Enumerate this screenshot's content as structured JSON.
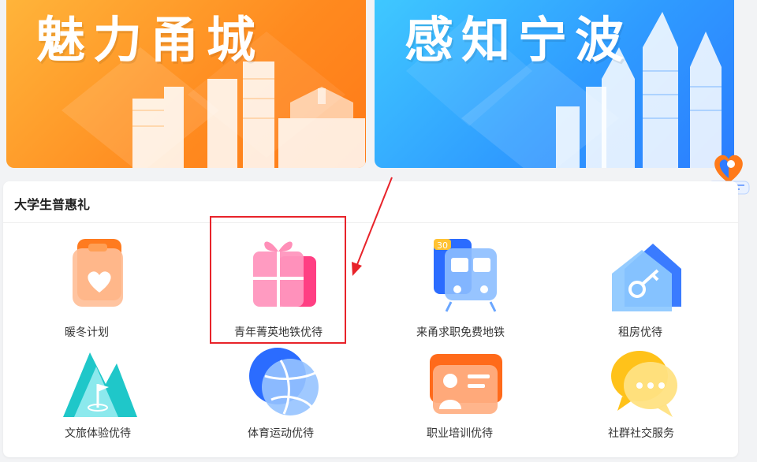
{
  "banners": [
    {
      "title": "魅力甬城"
    },
    {
      "title": "感知宁波"
    }
  ],
  "section": {
    "title": "大学生普惠礼",
    "items": [
      {
        "label": "暖冬计划",
        "icon": "heart-card-icon"
      },
      {
        "label": "青年菁英地铁优待",
        "icon": "gift-box-icon"
      },
      {
        "label": "来甬求职免费地铁",
        "icon": "metro-train-icon"
      },
      {
        "label": "租房优待",
        "icon": "house-key-icon"
      },
      {
        "label": "文旅体验优待",
        "icon": "mountain-flag-icon"
      },
      {
        "label": "体育运动优待",
        "icon": "basketball-icon"
      },
      {
        "label": "职业培训优待",
        "icon": "trainer-board-icon"
      },
      {
        "label": "社群社交服务",
        "icon": "chat-bubbles-icon"
      }
    ]
  },
  "train_badge": "30",
  "colors": {
    "highlight": "#e8232a",
    "orange": "#ff8a1f",
    "blue": "#2f9bff"
  }
}
